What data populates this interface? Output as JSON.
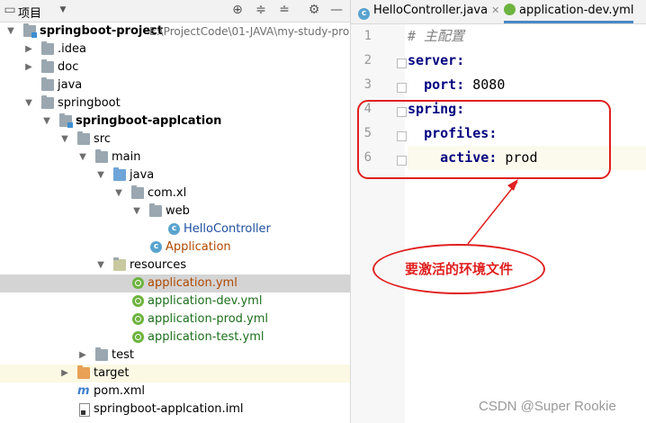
{
  "toolbar": {
    "title": "项目",
    "icons": [
      "target-icon",
      "collapse-icon",
      "expand-icon",
      "gear-icon",
      "minimize-icon"
    ]
  },
  "tree": {
    "root_label": "springboot-project",
    "root_path": "E:\\ProjectCode\\01-JAVA\\my-study-pro",
    "idea": ".idea",
    "doc": "doc",
    "java_top": "java",
    "springboot": "springboot",
    "module": "springboot-applcation",
    "src": "src",
    "main": "main",
    "java": "java",
    "com_xl": "com.xl",
    "web": "web",
    "hello_controller": "HelloController",
    "application_class": "Application",
    "resources": "resources",
    "app_yml": "application.yml",
    "app_dev_yml": "application-dev.yml",
    "app_prod_yml": "application-prod.yml",
    "app_test_yml": "application-test.yml",
    "test": "test",
    "target": "target",
    "pom": "pom.xml",
    "iml": "springboot-applcation.iml"
  },
  "tabs": [
    {
      "label": "HelloController.java",
      "icon": "class-icon"
    },
    {
      "label": "application-dev.yml",
      "icon": "spring-icon"
    }
  ],
  "code": {
    "line_numbers": [
      "1",
      "2",
      "3",
      "4",
      "5",
      "6"
    ],
    "l1_comment": "# 主配置",
    "l2_key": "server",
    "l2_colon": ":",
    "l3_key": "port",
    "l3_colon": ": ",
    "l3_val": "8080",
    "l4_key": "spring",
    "l4_colon": ":",
    "l5_key": "profiles",
    "l5_colon": ":",
    "l6_key": "active",
    "l6_colon": ": ",
    "l6_val": "prod"
  },
  "annotation": {
    "callout_text": "要激活的环境文件",
    "color": "#e02020"
  },
  "watermark": "CSDN @Super Rookie"
}
